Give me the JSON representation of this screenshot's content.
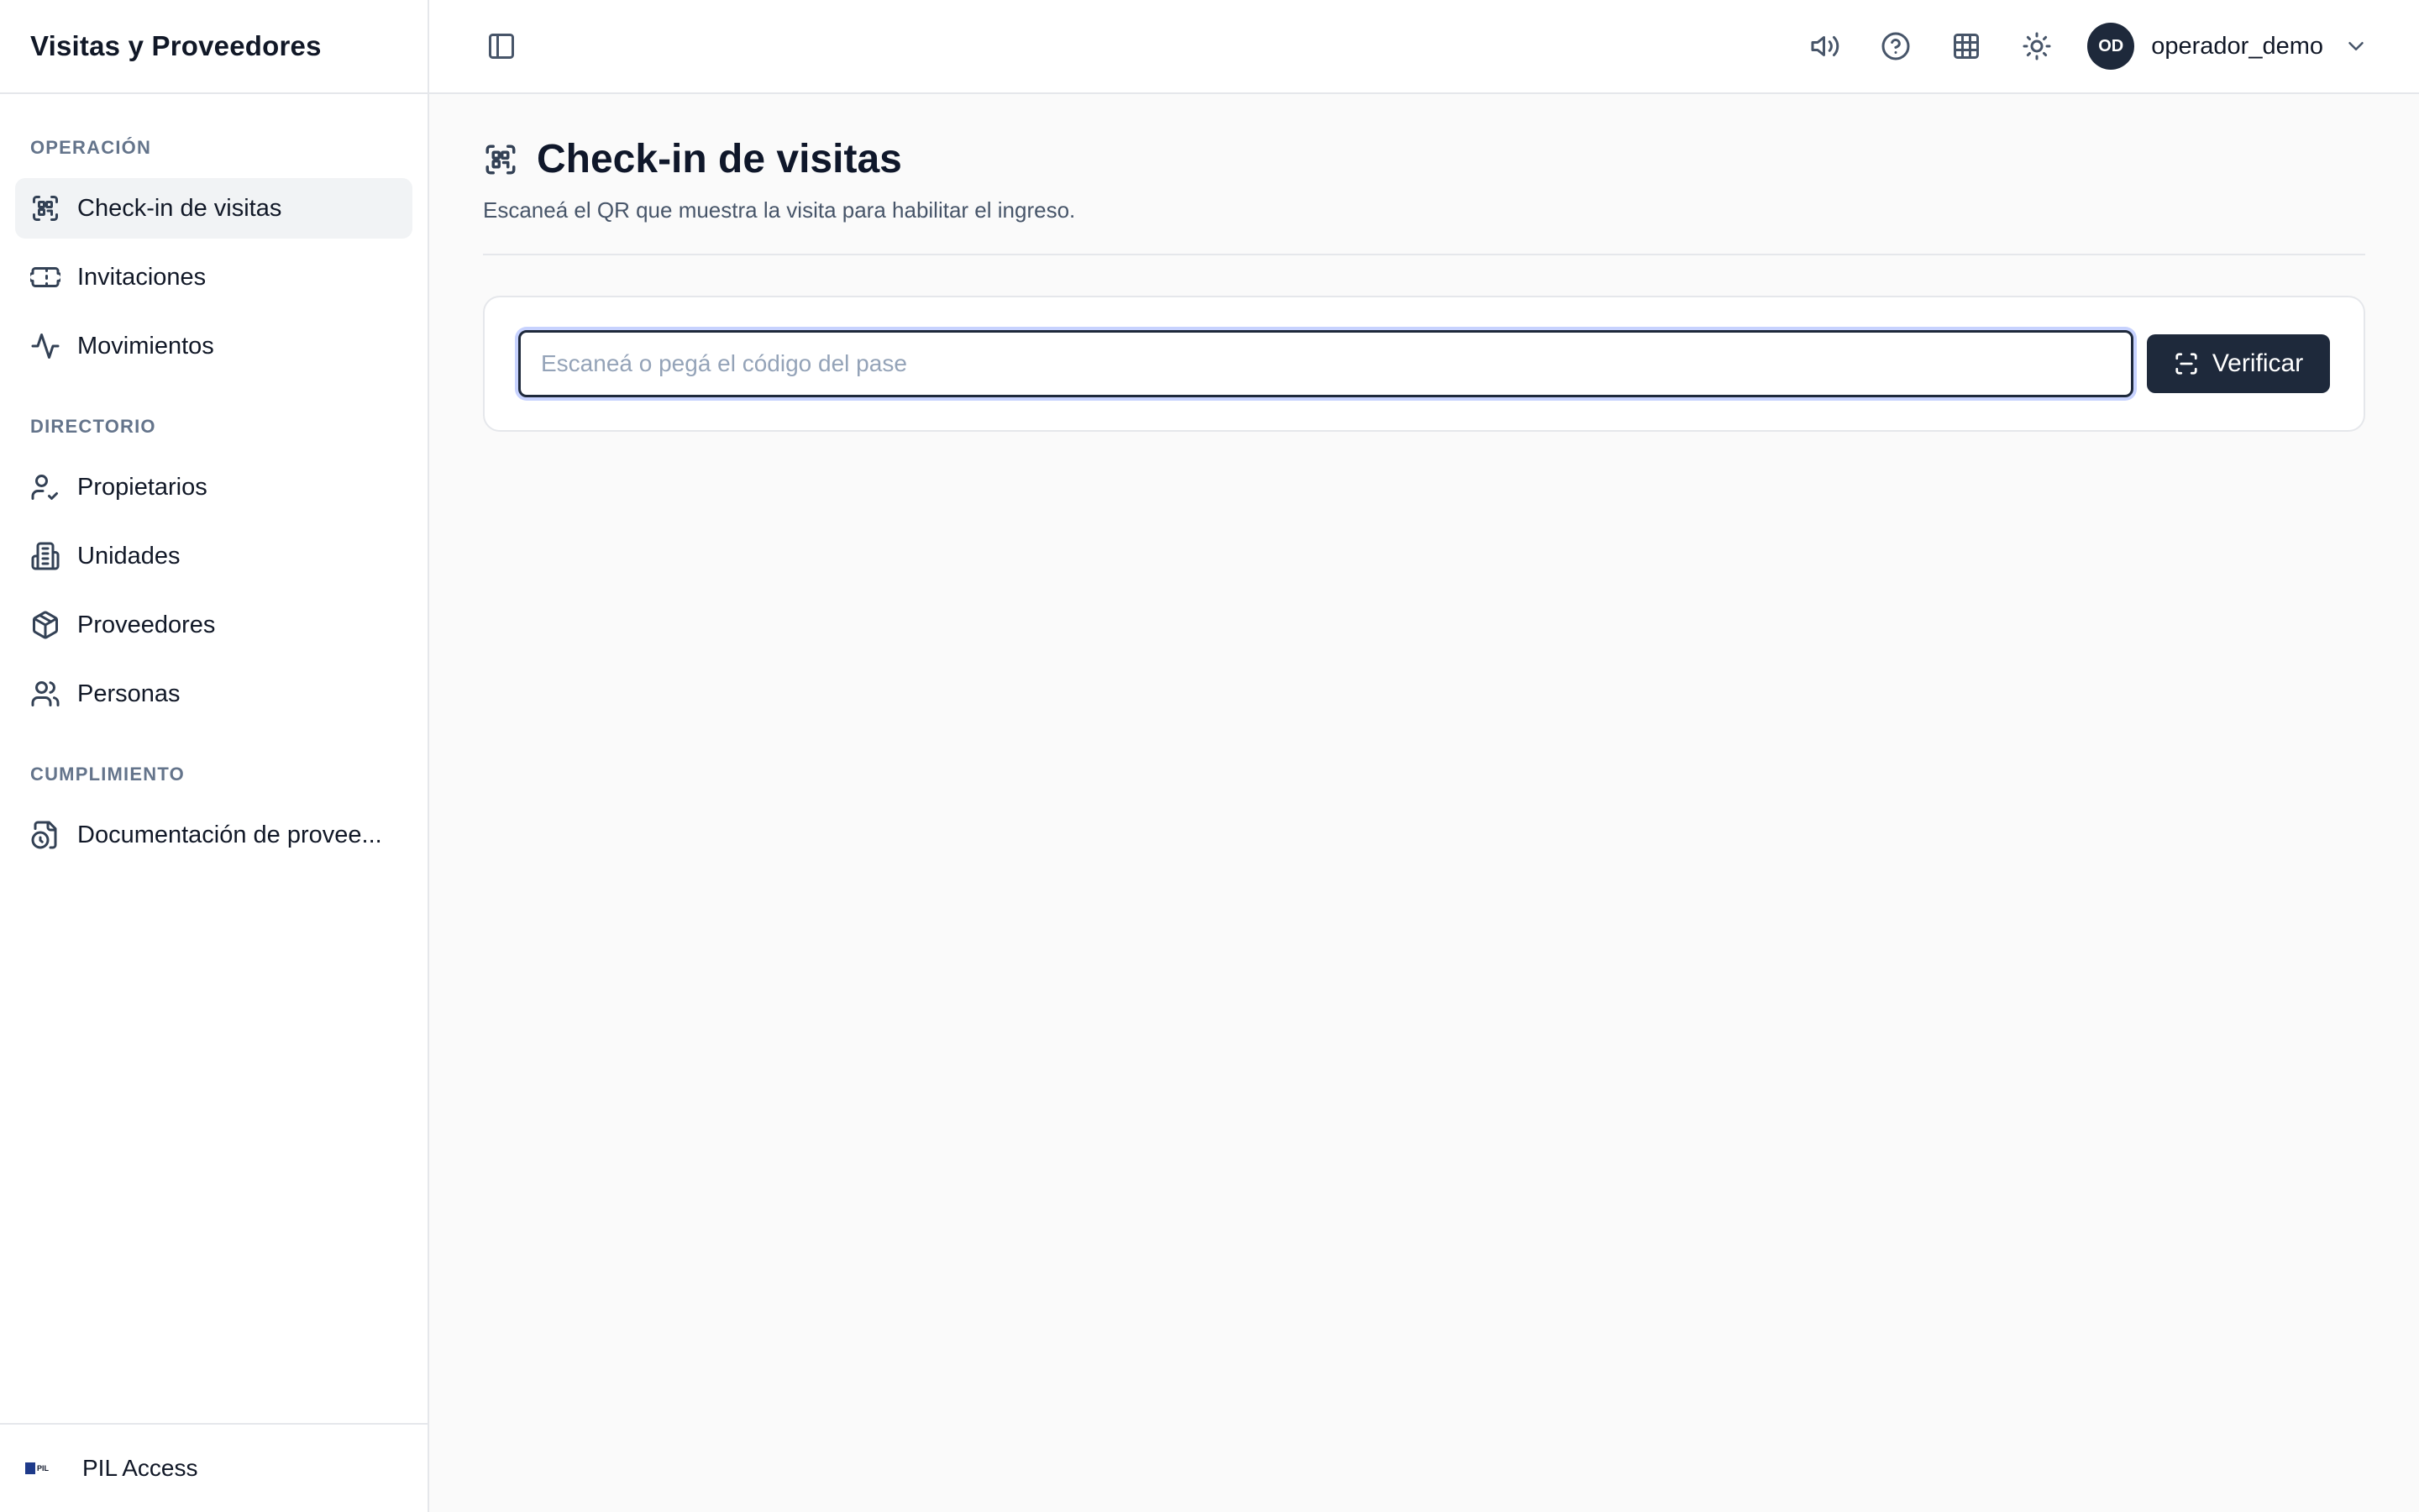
{
  "app": {
    "title": "Visitas y Proveedores"
  },
  "sidebar": {
    "sections": [
      {
        "label": "OPERACIÓN",
        "items": [
          {
            "label": "Check-in de visitas",
            "icon": "scan-qr-icon",
            "active": true
          },
          {
            "label": "Invitaciones",
            "icon": "ticket-icon"
          },
          {
            "label": "Movimientos",
            "icon": "activity-icon"
          }
        ]
      },
      {
        "label": "DIRECTORIO",
        "items": [
          {
            "label": "Propietarios",
            "icon": "user-check-icon"
          },
          {
            "label": "Unidades",
            "icon": "building-icon"
          },
          {
            "label": "Proveedores",
            "icon": "package-icon"
          },
          {
            "label": "Personas",
            "icon": "users-icon"
          }
        ]
      },
      {
        "label": "CUMPLIMIENTO",
        "items": [
          {
            "label": "Documentación de provee...",
            "icon": "file-clock-icon"
          }
        ]
      }
    ],
    "footer": {
      "label": "PIL Access",
      "logo_text": "PIL"
    }
  },
  "topbar": {
    "icons": [
      "sidebar-toggle-icon",
      "speaker-icon",
      "help-icon",
      "grid-icon",
      "sun-icon"
    ],
    "user": {
      "initials": "OD",
      "name": "operador_demo"
    }
  },
  "page": {
    "title": "Check-in de visitas",
    "subtitle": "Escaneá el QR que muestra la visita para habilitar el ingreso.",
    "input": {
      "value": "",
      "placeholder": "Escaneá o pegá el código del pase"
    },
    "verify_label": "Verificar"
  },
  "colors": {
    "accent": "#1e3a8a",
    "button_bg": "#1e293b",
    "sidebar_active_bg": "#f1f3f5",
    "page_bg": "#fafafa"
  }
}
